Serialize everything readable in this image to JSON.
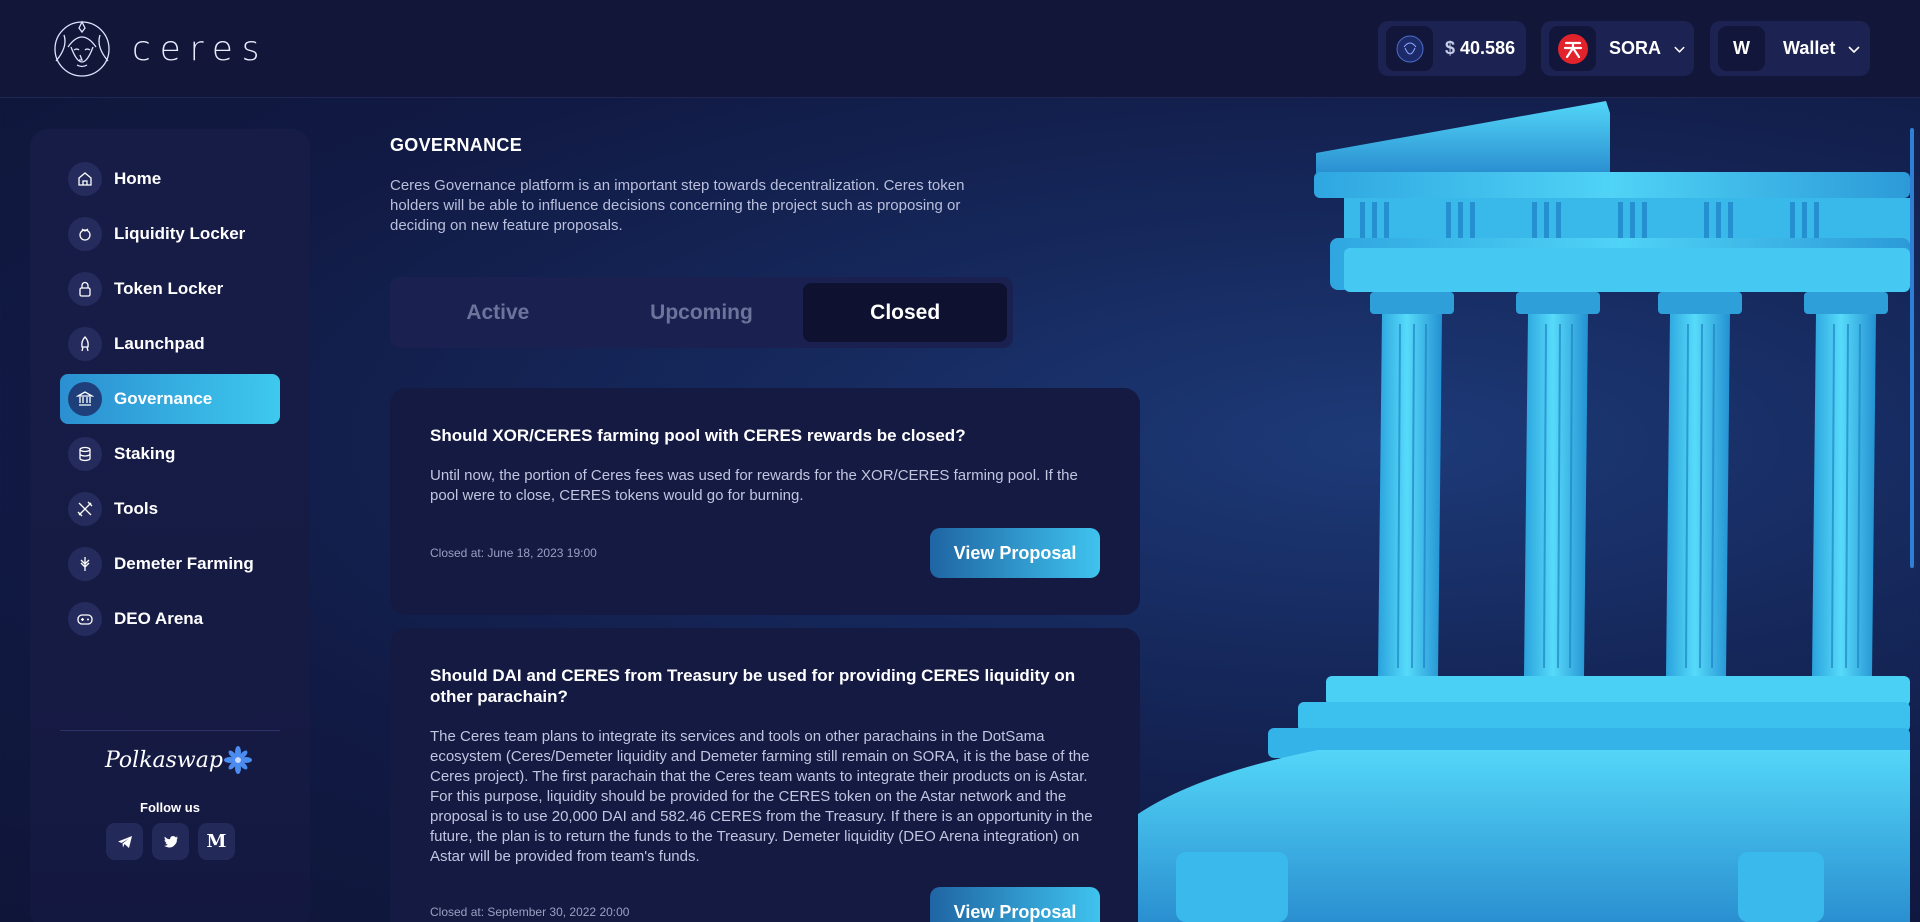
{
  "header": {
    "logo_text": "ceres",
    "price": {
      "currency": "$",
      "value": "40.586"
    },
    "network": {
      "label": "SORA",
      "icon": "sora-icon"
    },
    "wallet": {
      "letter": "W",
      "label": "Wallet"
    }
  },
  "sidebar": {
    "items": [
      {
        "label": "Home",
        "icon": "home-icon",
        "active": false
      },
      {
        "label": "Liquidity Locker",
        "icon": "liquidity-icon",
        "active": false
      },
      {
        "label": "Token Locker",
        "icon": "lock-icon",
        "active": false
      },
      {
        "label": "Launchpad",
        "icon": "rocket-icon",
        "active": false
      },
      {
        "label": "Governance",
        "icon": "bank-icon",
        "active": true
      },
      {
        "label": "Staking",
        "icon": "database-icon",
        "active": false
      },
      {
        "label": "Tools",
        "icon": "tools-icon",
        "active": false
      },
      {
        "label": "Demeter Farming",
        "icon": "wheat-icon",
        "active": false
      },
      {
        "label": "DEO Arena",
        "icon": "gamepad-icon",
        "active": false
      }
    ],
    "polkaswap": "Polkaswap",
    "follow_label": "Follow us",
    "socials": [
      "telegram-icon",
      "twitter-icon",
      "medium-icon"
    ],
    "medium_letter": "M"
  },
  "main": {
    "title": "GOVERNANCE",
    "description": "Ceres Governance platform is an important step towards decentralization. Ceres token holders will be able to influence decisions concerning the project such as proposing or deciding on new feature proposals.",
    "tabs": [
      {
        "label": "Active",
        "selected": false
      },
      {
        "label": "Upcoming",
        "selected": false
      },
      {
        "label": "Closed",
        "selected": true
      }
    ],
    "proposals": [
      {
        "title": "Should XOR/CERES farming pool with CERES rewards be closed?",
        "body": "Until now, the portion of Ceres fees was used for rewards for the XOR/CERES farming pool. If the pool were to close, CERES tokens would go for burning.",
        "closed_at": "Closed at: June 18, 2023 19:00",
        "button": "View Proposal"
      },
      {
        "title": "Should DAI and CERES from Treasury be used for providing CERES liquidity on other parachain?",
        "body": "The Ceres team plans to integrate its services and tools on other parachains in the DotSama ecosystem (Ceres/Demeter liquidity and Demeter farming still remain on SORA, it is the base of the Ceres project). The first parachain that the Ceres team wants to integrate their products on is Astar. For this purpose, liquidity should be provided for the CERES token on the Astar network and the proposal is to use 20,000 DAI and 582.46 CERES from the Treasury. If there is an opportunity in the future, the plan is to return the funds to the Treasury. Demeter liquidity (DEO Arena integration) on Astar will be provided from team's funds.",
        "closed_at": "Closed at: September 30, 2022 20:00",
        "button": "View Proposal"
      }
    ]
  },
  "colors": {
    "accent_start": "#2b8fd1",
    "accent_end": "#3ec9ee",
    "background": "#111a44",
    "card": "#151a43",
    "temple": "#3cc4ee"
  }
}
